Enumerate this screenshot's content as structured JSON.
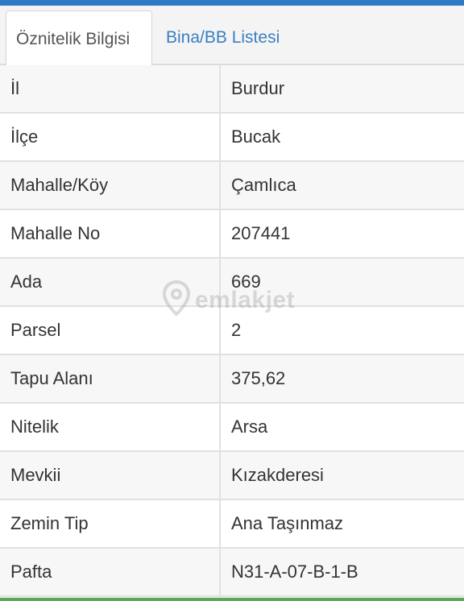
{
  "tabs": [
    {
      "label": "Öznitelik Bilgisi",
      "active": true
    },
    {
      "label": "Bina/BB Listesi",
      "active": false
    }
  ],
  "rows": [
    {
      "key": "İl",
      "value": "Burdur"
    },
    {
      "key": "İlçe",
      "value": "Bucak"
    },
    {
      "key": "Mahalle/Köy",
      "value": "Çamlıca"
    },
    {
      "key": "Mahalle No",
      "value": "207441"
    },
    {
      "key": "Ada",
      "value": "669"
    },
    {
      "key": "Parsel",
      "value": "2"
    },
    {
      "key": "Tapu Alanı",
      "value": "375,62"
    },
    {
      "key": "Nitelik",
      "value": "Arsa"
    },
    {
      "key": "Mevkii",
      "value": "Kızakderesi"
    },
    {
      "key": "Zemin Tip",
      "value": "Ana Taşınmaz"
    },
    {
      "key": "Pafta",
      "value": "N31-A-07-B-1-B"
    }
  ],
  "watermark": {
    "text": "emlakjet",
    "icon": "location-pin-icon"
  },
  "colors": {
    "top_bar": "#2f78c4",
    "active_tab_text": "#555555",
    "inactive_tab_text": "#3a7fc0",
    "bottom_bar": "#5aa85a"
  }
}
